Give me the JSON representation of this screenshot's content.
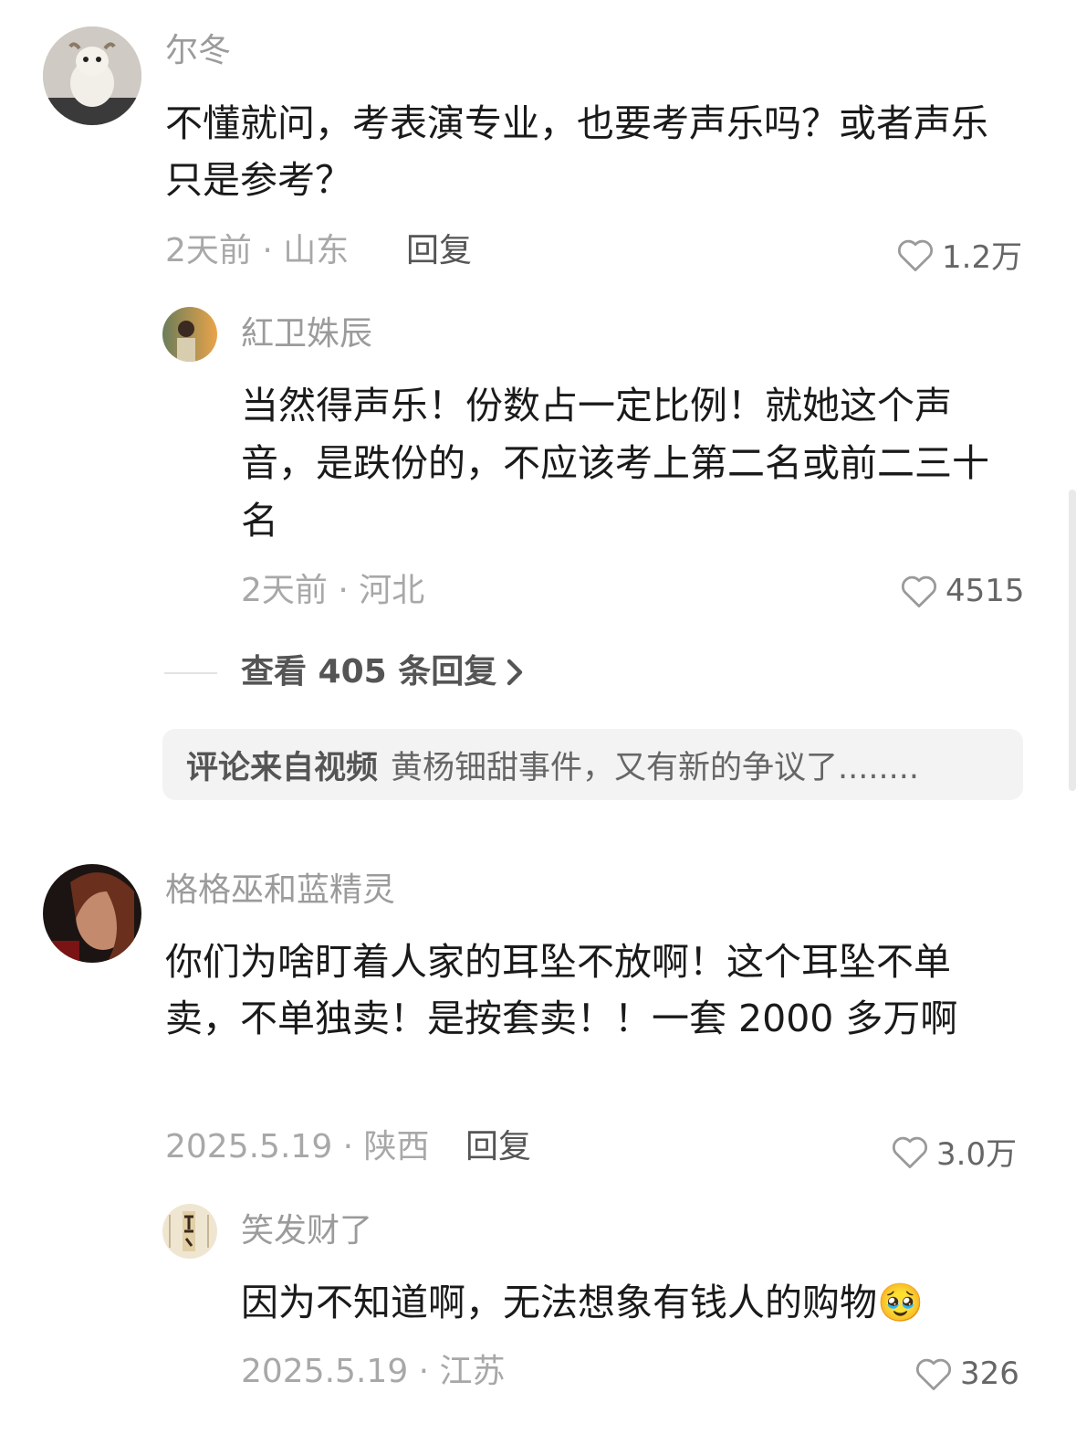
{
  "comments": [
    {
      "username": "尔冬",
      "avatar": "goat-plush-avatar",
      "text": "不懂就问，考表演专业，也要考声乐吗？或者声乐只是参考？",
      "meta": "2天前 · 山东",
      "reply_label": "回复",
      "likes": "1.2万",
      "replies": [
        {
          "username": "紅卫姝辰",
          "avatar": "sunset-portrait-avatar",
          "text": "当然得声乐！份数占一定比例！就她这个声音，是跌份的，不应该考上第二名或前二三十名",
          "meta": "2天前 · 河北",
          "likes": "4515"
        }
      ],
      "view_more": "查看 405 条回复",
      "source_label": "评论来自视频",
      "source_title": "黄杨钿甜事件，又有新的争议了........"
    },
    {
      "username": "格格巫和蓝精灵",
      "avatar": "woman-portrait-avatar",
      "text": "你们为啥盯着人家的耳坠不放啊！这个耳坠不单卖，不单独卖！是按套卖！！一套 2000 多万啊",
      "meta": "2025.5.19 · 陕西",
      "reply_label": "回复",
      "likes": "3.0万",
      "replies": [
        {
          "username": "笑发财了",
          "avatar": "calligraphy-poster-avatar",
          "text": "因为不知道啊，无法想象有钱人的购物",
          "emoji": "🥹",
          "meta": "2025.5.19 · 江苏",
          "likes": "326"
        }
      ]
    }
  ],
  "icons": {
    "like": "heart-outline-icon",
    "more": "chevron-right-icon"
  }
}
